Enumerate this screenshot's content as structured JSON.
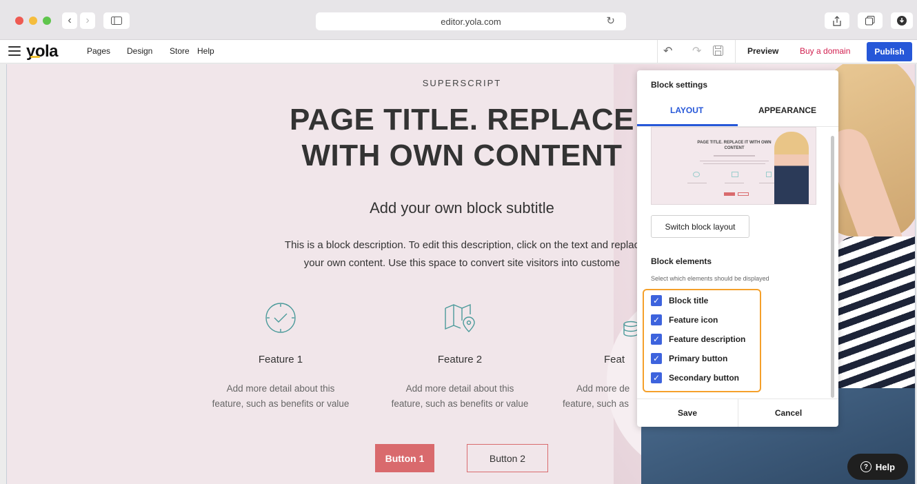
{
  "browser": {
    "url": "editor.yola.com"
  },
  "toolbar": {
    "logo": "yola",
    "menu": [
      "Pages",
      "Design",
      "Store",
      "Help"
    ],
    "preview": "Preview",
    "buy_domain": "Buy a domain",
    "publish": "Publish"
  },
  "block": {
    "superscript": "SUPERSCRIPT",
    "title_line1": "PAGE TITLE. REPLACE",
    "title_line2": "WITH OWN CONTENT",
    "subtitle": "Add your own block subtitle",
    "description_line1": "This is a block description. To edit this description, click on the text and replac",
    "description_line2": "your own content. Use this space to convert site visitors into custome",
    "features": [
      {
        "name": "Feature 1",
        "desc_line1": "Add more detail about this",
        "desc_line2": "feature, such as benefits or value",
        "icon": "clock-icon"
      },
      {
        "name": "Feature 2",
        "desc_line1": "Add more detail about this",
        "desc_line2": "feature, such as benefits or value",
        "icon": "map-icon"
      },
      {
        "name": "Feat",
        "desc_line1": "Add more de",
        "desc_line2": "feature, such as",
        "icon": "database-icon"
      }
    ],
    "button1": "Button 1",
    "button2": "Button 2"
  },
  "panel": {
    "title": "Block settings",
    "tabs": [
      "LAYOUT",
      "APPEARANCE"
    ],
    "active_tab": "LAYOUT",
    "thumb_title": "PAGE TITLE. REPLACE IT WITH OWN CONTENT",
    "switch_layout": "Switch block layout",
    "elements_title": "Block elements",
    "elements_subtitle": "Select which elements should be displayed",
    "elements": [
      {
        "label": "Block title",
        "checked": true
      },
      {
        "label": "Feature icon",
        "checked": true
      },
      {
        "label": "Feature description",
        "checked": true
      },
      {
        "label": "Primary button",
        "checked": true
      },
      {
        "label": "Secondary button",
        "checked": true
      }
    ],
    "save": "Save",
    "cancel": "Cancel"
  },
  "help": "Help",
  "colors": {
    "accent": "#2657d8",
    "brand_red": "#d11e4e",
    "button_red": "#d96a6d",
    "highlight": "#f5a02a",
    "checkbox": "#3d63dd"
  }
}
